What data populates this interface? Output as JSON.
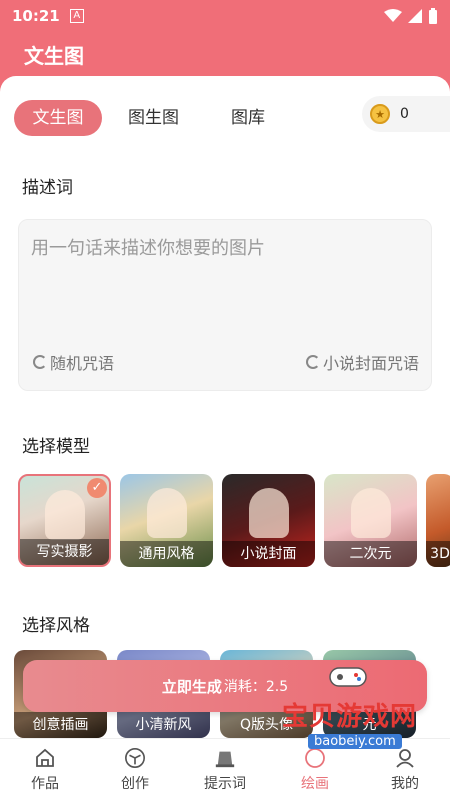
{
  "status": {
    "time": "10:21",
    "a_label": "A"
  },
  "header": {
    "title": "文生图"
  },
  "tabs": [
    {
      "label": "文生图",
      "active": true
    },
    {
      "label": "图生图",
      "active": false
    },
    {
      "label": "图库",
      "active": false
    }
  ],
  "coins": {
    "value": "0"
  },
  "prompt": {
    "section_title": "描述词",
    "placeholder": "用一句话来描述你想要的图片",
    "random_label": "随机咒语",
    "novel_label": "小说封面咒语"
  },
  "models": {
    "section_title": "选择模型",
    "items": [
      {
        "label": "写实摄影",
        "selected": true
      },
      {
        "label": "通用风格",
        "selected": false
      },
      {
        "label": "小说封面",
        "selected": false
      },
      {
        "label": "二次元",
        "selected": false
      },
      {
        "label": "3D",
        "selected": false
      }
    ]
  },
  "styles": {
    "section_title": "选择风格",
    "items": [
      {
        "label": "创意插画"
      },
      {
        "label": "小清新风"
      },
      {
        "label": "Q版头像"
      },
      {
        "label": "元"
      }
    ]
  },
  "generate": {
    "label": "立即生成",
    "cost": "消耗：2.5"
  },
  "nav": [
    {
      "label": "作品",
      "icon": "home-icon"
    },
    {
      "label": "创作",
      "icon": "cube-icon"
    },
    {
      "label": "提示词",
      "icon": "printer-icon"
    },
    {
      "label": "绘画",
      "icon": "palette-icon"
    },
    {
      "label": "我的",
      "icon": "user-icon"
    }
  ],
  "watermark": {
    "title": "宝贝游戏网",
    "url": "baobeiy.com"
  },
  "colors": {
    "accent": "#e8737a",
    "header": "#f06e78"
  }
}
